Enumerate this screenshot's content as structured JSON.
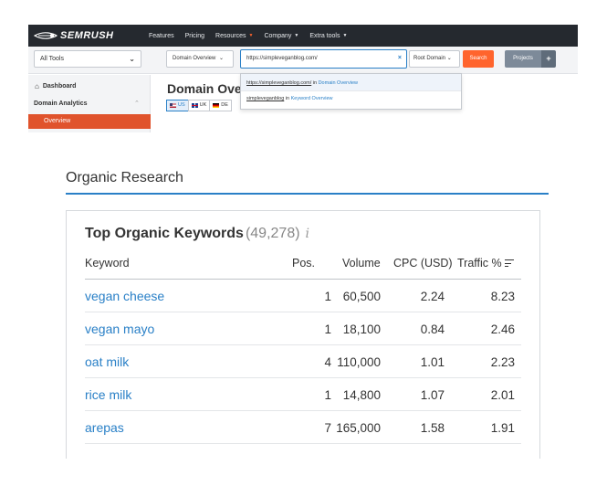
{
  "app": {
    "brand": "SEMRUSH",
    "nav": [
      {
        "label": "Features",
        "caret": ""
      },
      {
        "label": "Pricing",
        "caret": ""
      },
      {
        "label": "Resources",
        "caret": "▼"
      },
      {
        "label": "Company",
        "caret": "▼"
      },
      {
        "label": "Extra tools",
        "caret": "▼"
      }
    ],
    "tools_select": "All Tools",
    "report_select": "Domain Overview",
    "url_value": "https://simpleveganblog.com/",
    "clear_icon": "×",
    "scope_select": "Root Domain",
    "search_label": "Search",
    "projects_label": "Projects",
    "plus_label": "+",
    "suggestions": [
      {
        "text": "https://simpleveganblog.com/",
        "in": " in ",
        "target": "Domain Overview"
      },
      {
        "text": "simpleveganblog",
        "in": " in ",
        "target": "Keyword Overview"
      }
    ],
    "sidebar": {
      "dashboard": "Dashboard",
      "section": "Domain Analytics",
      "active_item": "Overview"
    },
    "page_title": "Domain Ove",
    "databases": [
      "US",
      "UK",
      "DE"
    ],
    "colors": {
      "accent": "#ff642d",
      "link": "#2a80c7",
      "nav_bg": "#25292f",
      "active": "#e0532c"
    }
  },
  "section_title": "Organic Research",
  "widget": {
    "title": "Top Organic Keywords",
    "count": "(49,278)",
    "info_icon": "i",
    "columns": {
      "keyword": "Keyword",
      "pos": "Pos.",
      "volume": "Volume",
      "cpc": "CPC (USD)",
      "traffic": "Traffic %"
    },
    "rows": [
      {
        "keyword": "vegan cheese",
        "pos": "1",
        "volume": "60,500",
        "cpc": "2.24",
        "traffic": "8.23"
      },
      {
        "keyword": "vegan mayo",
        "pos": "1",
        "volume": "18,100",
        "cpc": "0.84",
        "traffic": "2.46"
      },
      {
        "keyword": "oat milk",
        "pos": "4",
        "volume": "110,000",
        "cpc": "1.01",
        "traffic": "2.23"
      },
      {
        "keyword": "rice milk",
        "pos": "1",
        "volume": "14,800",
        "cpc": "1.07",
        "traffic": "2.01"
      },
      {
        "keyword": "arepas",
        "pos": "7",
        "volume": "165,000",
        "cpc": "1.58",
        "traffic": "1.91"
      }
    ]
  }
}
